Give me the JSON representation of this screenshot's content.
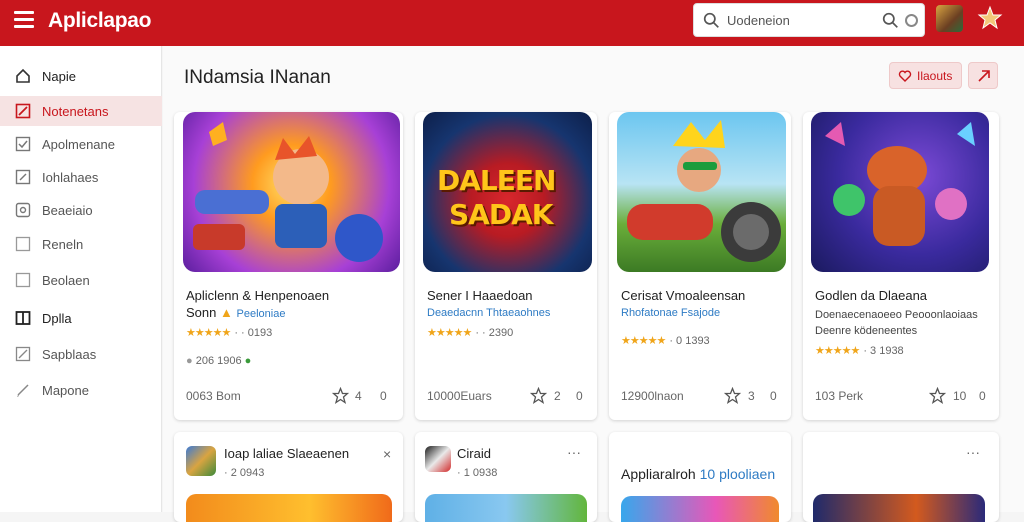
{
  "header": {
    "brand": "Apliclapao",
    "search_text": "Uodeneion",
    "colors": {
      "header_bg": "#c8161d",
      "accent": "#c8161d",
      "star": "#f0a51a",
      "link": "#2e7bc4"
    }
  },
  "sidebar": {
    "items": [
      {
        "label": "Napie",
        "icon": "home-icon"
      },
      {
        "label": "Notenetans",
        "icon": "edit-icon",
        "active": true
      },
      {
        "label": "Apolmenane",
        "icon": "check-square-icon"
      },
      {
        "label": "Iohlahaes",
        "icon": "pencil-square-icon"
      },
      {
        "label": "Beaeiaio",
        "icon": "settings-square-icon"
      },
      {
        "label": "Reneln",
        "icon": "square-icon"
      },
      {
        "label": "Beolaen",
        "icon": "square-icon"
      },
      {
        "label": "Dplla",
        "icon": "book-icon"
      },
      {
        "label": "Sapblaas",
        "icon": "pencil-square-icon"
      },
      {
        "label": "Mapone",
        "icon": "pen-icon"
      }
    ]
  },
  "main": {
    "title": "INdamsia INanan",
    "views_label": "Ilaouts",
    "cards": [
      {
        "title_line1": "Apliclenn & Henpenoaen",
        "title_line2": "Sonn",
        "subtitle": "Peeloniae",
        "rating_text": "· · 0193",
        "meta_text": "206 1906",
        "price": "0063 Bom",
        "fav_count": "4",
        "zero": "0"
      },
      {
        "title_line1": "Sener I Haaedoan",
        "title_line2": "",
        "subtitle": "Deaedacnn Thtaeaohnes",
        "rating_text": "· · 2390",
        "meta_text": "",
        "price": "10000Euars",
        "fav_count": "2",
        "zero": "0",
        "logo_line1": "DALEEN",
        "logo_line2": "SADAK"
      },
      {
        "title_line1": "Cerisat Vmoaleensan",
        "title_line2": "",
        "subtitle": "Rhofatonae Fsajode",
        "rating_text": "· 0 1393",
        "meta_text": "",
        "price": "12900lnaon",
        "fav_count": "3",
        "zero": "0"
      },
      {
        "title_line1": "Godlen da Dlaeana",
        "title_line2": "",
        "subtitle": "Doenaecenaoeeo Peooonlaoiaas",
        "subtitle_line2": "Deenre ködeneentes",
        "rating_text": "· 3 1938",
        "meta_text": "",
        "price": "103 Perk",
        "fav_count": "10",
        "zero": "0"
      }
    ],
    "lower_cards": [
      {
        "title": "Ioap laliae Slaeaenen",
        "meta": "· 2 0943",
        "action": "×"
      },
      {
        "title": "Ciraid",
        "meta": "· 1 0938",
        "action": "···"
      },
      {
        "title": "Appliaralroh",
        "title_accent": "10 plooliaen",
        "meta": "",
        "action": ""
      },
      {
        "title": "",
        "meta": "",
        "action": "···"
      }
    ]
  }
}
